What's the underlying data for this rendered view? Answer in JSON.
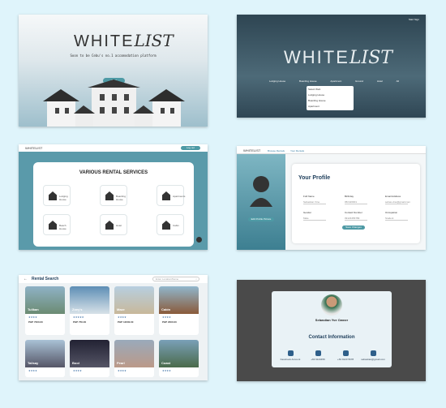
{
  "panel1": {
    "brand_light": "WHITE",
    "brand_bold": "LIST",
    "tagline": "Soon to be Cebu's no.1 accomodation platform",
    "cta": "Start"
  },
  "panel2": {
    "login": "Start Sign",
    "brand_light": "WHITE",
    "brand_bold": "LIST",
    "menu": [
      "Lodging House",
      "Boarding House",
      "Apartment",
      "Ground",
      "Hotel",
      "All"
    ],
    "popup_title": "Select Web",
    "popup_rows": [
      "Lodging House",
      "Boarding House",
      "Apartment",
      "Ground"
    ]
  },
  "panel3": {
    "brand": "WHITELIST",
    "nav_btn": "Log out",
    "title": "VARIOUS RENTAL SERVICES",
    "services": [
      "Lodging House",
      "Boarding House",
      "Apartments",
      "Beach House",
      "Hotel",
      "Cabin"
    ]
  },
  "panel4": {
    "brand": "WHITELIST",
    "nav": [
      "Browse Rentals",
      "Your Rentals"
    ],
    "title": "Your Profile",
    "avatar_btn": "Edit Profile Picture",
    "fields": [
      {
        "label": "Full Name",
        "value": "Sebastian Vine"
      },
      {
        "label": "Birthday",
        "value": "05/10/2001"
      },
      {
        "label": "Email Address",
        "value": "sebas.vine@gmail.com"
      },
      {
        "label": "Gender",
        "value": "Male"
      },
      {
        "label": "Contact Number",
        "value": "09123456789"
      },
      {
        "label": "Occupation",
        "value": "Student"
      }
    ],
    "save_btn": "Save Changes"
  },
  "panel5": {
    "title": "Rental Search",
    "search_placeholder": "Enter Location/Name",
    "rentals": [
      {
        "name": "Tulikan",
        "price": "PHP 7000.00",
        "location": "Talisay City"
      },
      {
        "name": "Zoey's",
        "price": "PHP 750.00",
        "location": "Talisay City"
      },
      {
        "name": "Maze",
        "price": "PHP 12000.00",
        "location": "Talisay City"
      },
      {
        "name": "Cabin",
        "price": "PHP 2000.00",
        "location": "Talisay City"
      },
      {
        "name": "Talisay",
        "price": "",
        "location": "Talisay City"
      },
      {
        "name": "Bool",
        "price": "",
        "location": "Talisay City"
      },
      {
        "name": "Pearl",
        "price": "",
        "location": "Tabunok, Talisay City"
      },
      {
        "name": "Coast",
        "price": "",
        "location": "Talisay City"
      }
    ]
  },
  "panel6": {
    "name": "Sebastian Yve Owner",
    "heading": "Contact Information",
    "contacts": [
      "Facebook Account",
      "+63 9123456",
      "+63 9123 5678",
      "sebastian@gmail.com"
    ]
  }
}
